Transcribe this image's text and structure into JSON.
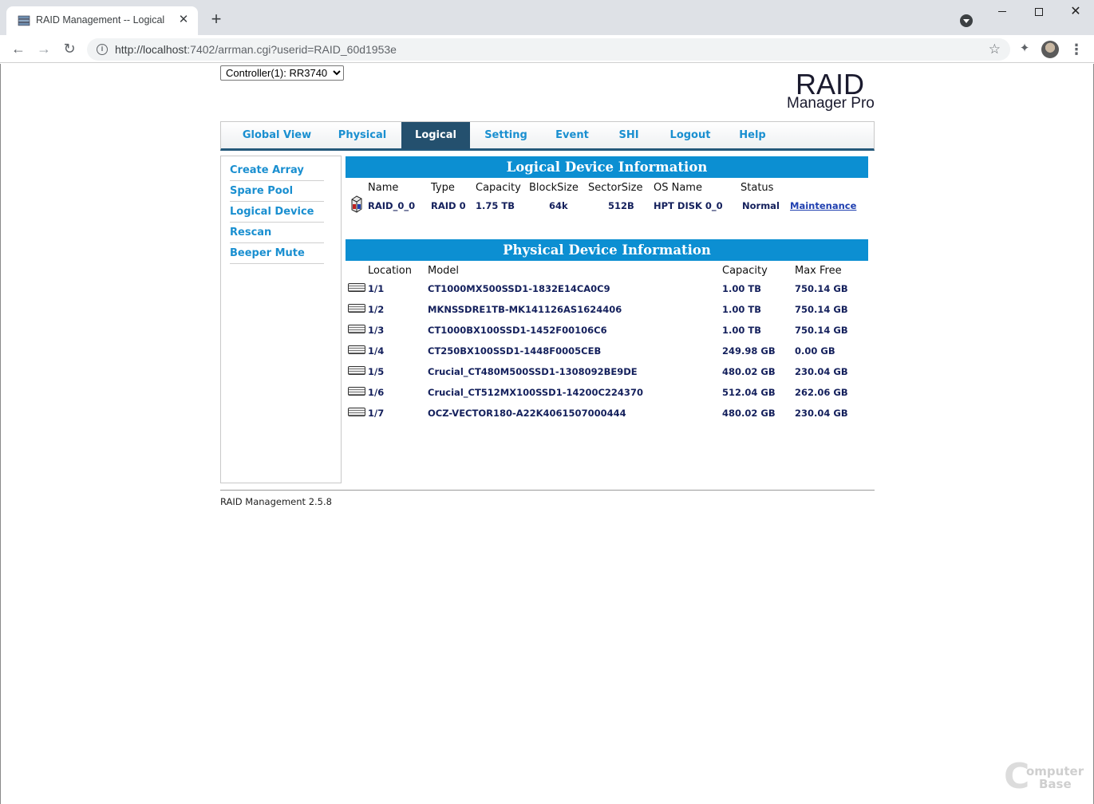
{
  "browser": {
    "tab_title": "RAID Management -- Logical",
    "close_glyph": "✕",
    "new_tab_glyph": "+",
    "url_host": "http://localhost",
    "url_rest": ":7402/arrman.cgi?userid=RAID_60d1953e",
    "star_glyph": "☆",
    "menu_glyph": "⋮",
    "back_glyph": "←",
    "forward_glyph": "→",
    "reload_glyph": "↻",
    "info_glyph": "i",
    "extensions_glyph": "✦"
  },
  "controller": {
    "options": [
      "Controller(1): RR3740"
    ],
    "selected": "Controller(1): RR3740"
  },
  "logo": {
    "title": "RAID",
    "subtitle": "Manager Pro"
  },
  "nav": {
    "tabs": [
      {
        "label": "Global View",
        "active": false
      },
      {
        "label": "Physical",
        "active": false
      },
      {
        "label": "Logical",
        "active": true
      },
      {
        "label": "Setting",
        "active": false
      },
      {
        "label": "Event",
        "active": false
      },
      {
        "label": "SHI",
        "active": false
      },
      {
        "label": "Logout",
        "active": false
      },
      {
        "label": "Help",
        "active": false
      }
    ]
  },
  "sidebar": {
    "items": [
      {
        "label": "Create Array"
      },
      {
        "label": "Spare Pool"
      },
      {
        "label": "Logical Device"
      },
      {
        "label": "Rescan"
      },
      {
        "label": "Beeper Mute"
      }
    ]
  },
  "logical": {
    "title": "Logical Device Information",
    "headers": {
      "name": "Name",
      "type": "Type",
      "capacity": "Capacity",
      "blocksize": "BlockSize",
      "sectorsize": "SectorSize",
      "osname": "OS Name",
      "status": "Status"
    },
    "rows": [
      {
        "name": "RAID_0_0",
        "type": "RAID 0",
        "capacity": "1.75 TB",
        "blocksize": "64k",
        "sectorsize": "512B",
        "osname": "HPT DISK 0_0",
        "status": "Normal",
        "action": "Maintenance"
      }
    ]
  },
  "physical": {
    "title": "Physical Device Information",
    "headers": {
      "location": "Location",
      "model": "Model",
      "capacity": "Capacity",
      "maxfree": "Max Free"
    },
    "rows": [
      {
        "location": "1/1",
        "model": "CT1000MX500SSD1-1832E14CA0C9",
        "capacity": "1.00 TB",
        "maxfree": "750.14 GB"
      },
      {
        "location": "1/2",
        "model": "MKNSSDRE1TB-MK141126AS1624406",
        "capacity": "1.00 TB",
        "maxfree": "750.14 GB"
      },
      {
        "location": "1/3",
        "model": "CT1000BX100SSD1-1452F00106C6",
        "capacity": "1.00 TB",
        "maxfree": "750.14 GB"
      },
      {
        "location": "1/4",
        "model": "CT250BX100SSD1-1448F0005CEB",
        "capacity": "249.98 GB",
        "maxfree": "0.00 GB"
      },
      {
        "location": "1/5",
        "model": "Crucial_CT480M500SSD1-1308092BE9DE",
        "capacity": "480.02 GB",
        "maxfree": "230.04 GB"
      },
      {
        "location": "1/6",
        "model": "Crucial_CT512MX100SSD1-14200C224370",
        "capacity": "512.04 GB",
        "maxfree": "262.06 GB"
      },
      {
        "location": "1/7",
        "model": "OCZ-VECTOR180-A22K4061507000444",
        "capacity": "480.02 GB",
        "maxfree": "230.04 GB"
      }
    ]
  },
  "footer": {
    "text": "RAID Management 2.5.8"
  },
  "watermark": {
    "letter": "C",
    "line1": "omputer",
    "line2": "Base"
  },
  "colors": {
    "tab_active_bg": "#24506e",
    "tab_text": "#1a8fd0",
    "section_bar": "#0c8fd2",
    "cell_text": "#14205c",
    "link": "#2040b0"
  }
}
